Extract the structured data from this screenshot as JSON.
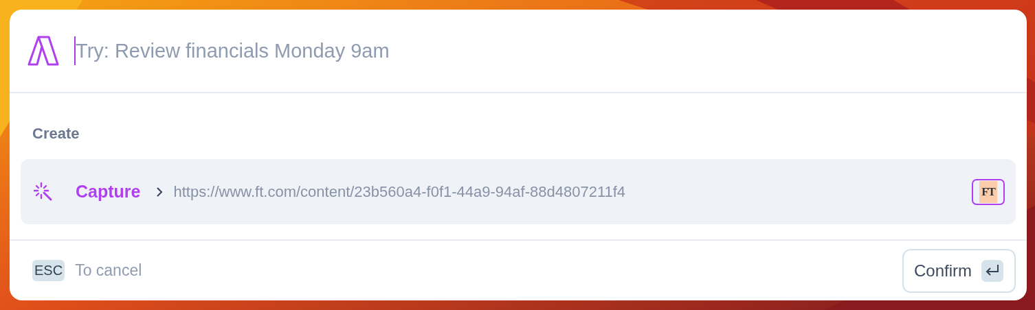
{
  "search": {
    "placeholder": "Try: Review financials Monday 9am"
  },
  "section": {
    "title": "Create",
    "items": [
      {
        "label": "Capture",
        "url": "https://www.ft.com/content/23b560a4-f0f1-44a9-94af-88d4807211f4",
        "favicon": "FT",
        "selected": true
      }
    ]
  },
  "footer": {
    "key": "ESC",
    "hint": "To cancel",
    "confirm": "Confirm"
  }
}
